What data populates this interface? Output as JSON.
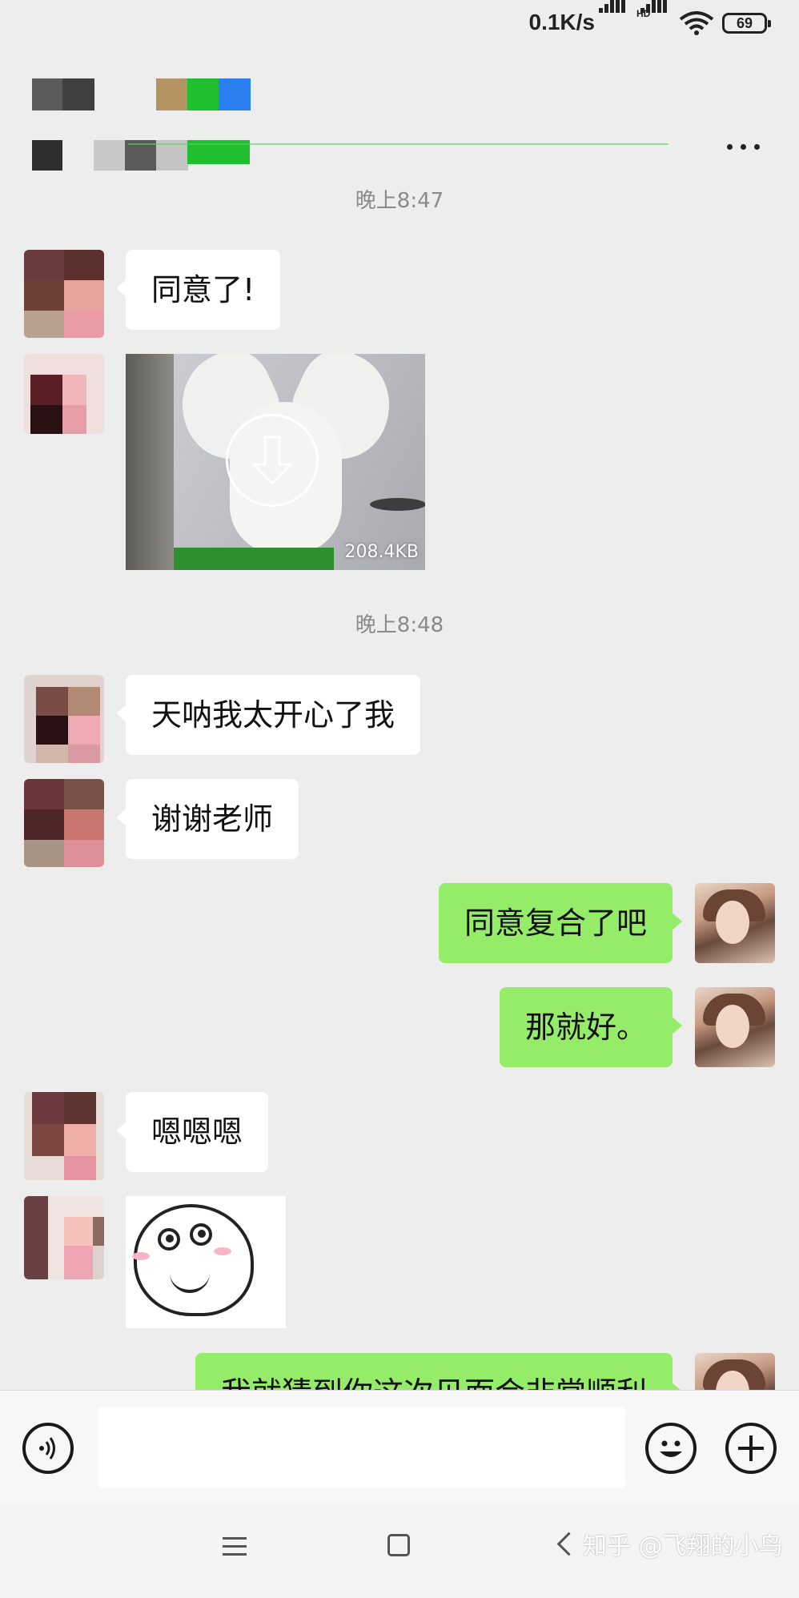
{
  "status_bar": {
    "net_speed": "0.1K/s",
    "hd_label": "HD",
    "battery_level": "69"
  },
  "header": {
    "more_icon": "more-dots-icon"
  },
  "messages": [
    {
      "type": "time",
      "text": "晚上8:47"
    },
    {
      "type": "text",
      "side": "in",
      "text": "同意了!"
    },
    {
      "type": "image",
      "side": "in",
      "file_size": "208.4KB",
      "icon": "download-icon"
    },
    {
      "type": "time",
      "text": "晚上8:48"
    },
    {
      "type": "text",
      "side": "in",
      "text": "天呐我太开心了我"
    },
    {
      "type": "text",
      "side": "in",
      "text": "谢谢老师"
    },
    {
      "type": "text",
      "side": "out",
      "text": "同意复合了吧"
    },
    {
      "type": "text",
      "side": "out",
      "text": "那就好。"
    },
    {
      "type": "text",
      "side": "in",
      "text": "嗯嗯嗯"
    },
    {
      "type": "sticker",
      "side": "in"
    },
    {
      "type": "text",
      "side": "out",
      "text": "我就猜到你这次见面会非常顺利"
    }
  ],
  "input_bar": {
    "voice_icon": "voice-icon",
    "emoji_icon": "emoji-icon",
    "plus_icon": "plus-icon",
    "message_value": ""
  },
  "nav_bar": {
    "menu_icon": "menu-icon",
    "home_icon": "home-icon",
    "back_icon": "back-icon"
  },
  "watermark": "知乎 @飞翔的小鸟",
  "colors": {
    "background": "#ededed",
    "outgoing_bubble": "#95ec69",
    "incoming_bubble": "#ffffff"
  }
}
